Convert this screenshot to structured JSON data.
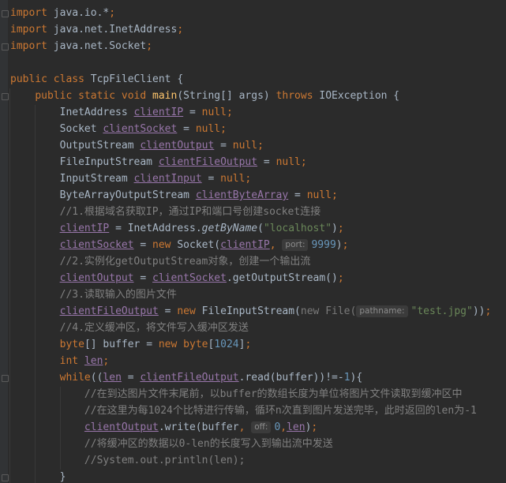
{
  "editor": {
    "theme": "darcula",
    "colors": {
      "background": "#2b2b2b",
      "gutter": "#313335",
      "text": "#a9b7c6",
      "keyword": "#cc7832",
      "method": "#ffc66d",
      "field": "#9876aa",
      "number": "#6897bb",
      "string": "#6a8759",
      "comment": "#808080",
      "hint": "#8c8c8c"
    },
    "lines": [
      [
        {
          "k": "kw",
          "t": "import"
        },
        {
          "t": " java.io.*"
        },
        {
          "k": "kw",
          "t": ";"
        }
      ],
      [
        {
          "k": "kw",
          "t": "import"
        },
        {
          "t": " java.net.InetAddress"
        },
        {
          "k": "kw",
          "t": ";"
        }
      ],
      [
        {
          "k": "kw",
          "t": "import"
        },
        {
          "t": " java.net.Socket"
        },
        {
          "k": "kw",
          "t": ";"
        }
      ],
      [],
      [
        {
          "k": "kw",
          "t": "public class "
        },
        {
          "t": "TcpFileClient {"
        }
      ],
      [
        {
          "t": "    "
        },
        {
          "k": "kw",
          "t": "public static void "
        },
        {
          "k": "fn",
          "t": "main"
        },
        {
          "t": "(String[] args) "
        },
        {
          "k": "kw",
          "t": "throws "
        },
        {
          "t": "IOException {"
        }
      ],
      [
        {
          "t": "        InetAddress "
        },
        {
          "k": "field",
          "t": "clientIP"
        },
        {
          "t": " = "
        },
        {
          "k": "kw",
          "t": "null;"
        }
      ],
      [
        {
          "t": "        Socket "
        },
        {
          "k": "field",
          "t": "clientSocket"
        },
        {
          "t": " = "
        },
        {
          "k": "kw",
          "t": "null;"
        }
      ],
      [
        {
          "t": "        OutputStream "
        },
        {
          "k": "field",
          "t": "clientOutput"
        },
        {
          "t": " = "
        },
        {
          "k": "kw",
          "t": "null;"
        }
      ],
      [
        {
          "t": "        FileInputStream "
        },
        {
          "k": "field",
          "t": "clientFileOutput"
        },
        {
          "t": " = "
        },
        {
          "k": "kw",
          "t": "null;"
        }
      ],
      [
        {
          "t": "        InputStream "
        },
        {
          "k": "field",
          "t": "clientInput"
        },
        {
          "t": " = "
        },
        {
          "k": "kw",
          "t": "null;"
        }
      ],
      [
        {
          "t": "        ByteArrayOutputStream "
        },
        {
          "k": "field",
          "t": "clientByteArray"
        },
        {
          "t": " = "
        },
        {
          "k": "kw",
          "t": "null;"
        }
      ],
      [
        {
          "t": "        "
        },
        {
          "k": "cmt",
          "t": "//1.根据域名获取IP，通过IP和端口号创建socket连接"
        }
      ],
      [
        {
          "t": "        "
        },
        {
          "k": "field",
          "t": "clientIP"
        },
        {
          "t": " = InetAddress."
        },
        {
          "k": "static",
          "t": "getByName"
        },
        {
          "t": "("
        },
        {
          "k": "str",
          "t": "\"localhost\""
        },
        {
          "t": ")"
        },
        {
          "k": "kw",
          "t": ";"
        }
      ],
      [
        {
          "t": "        "
        },
        {
          "k": "field",
          "t": "clientSocket"
        },
        {
          "t": " = "
        },
        {
          "k": "kw",
          "t": "new "
        },
        {
          "t": "Socket("
        },
        {
          "k": "field",
          "t": "clientIP"
        },
        {
          "k": "kw",
          "t": ", "
        },
        {
          "k": "hint",
          "t": "port:"
        },
        {
          "k": "num",
          "t": "9999"
        },
        {
          "t": ")"
        },
        {
          "k": "kw",
          "t": ";"
        }
      ],
      [
        {
          "t": "        "
        },
        {
          "k": "cmt",
          "t": "//2.实例化getOutputStream对象，创建一个输出流"
        }
      ],
      [
        {
          "t": "        "
        },
        {
          "k": "field",
          "t": "clientOutput"
        },
        {
          "t": " = "
        },
        {
          "k": "field",
          "t": "clientSocket"
        },
        {
          "t": ".getOutputStream()"
        },
        {
          "k": "kw",
          "t": ";"
        }
      ],
      [
        {
          "t": "        "
        },
        {
          "k": "cmt",
          "t": "//3.读取输入的图片文件"
        }
      ],
      [
        {
          "t": "        "
        },
        {
          "k": "field",
          "t": "clientFileOutput"
        },
        {
          "t": " = "
        },
        {
          "k": "kw",
          "t": "new "
        },
        {
          "t": "FileInputStream("
        },
        {
          "k": "faint",
          "t": "new File("
        },
        {
          "k": "hint",
          "t": "pathname:"
        },
        {
          "k": "str",
          "t": "\"test.jpg\""
        },
        {
          "t": "))"
        },
        {
          "k": "kw",
          "t": ";"
        }
      ],
      [
        {
          "t": "        "
        },
        {
          "k": "cmt",
          "t": "//4.定义缓冲区，将文件写入缓冲区发送"
        }
      ],
      [
        {
          "t": "        "
        },
        {
          "k": "kw",
          "t": "byte"
        },
        {
          "t": "[] buffer = "
        },
        {
          "k": "kw",
          "t": "new byte"
        },
        {
          "t": "["
        },
        {
          "k": "num",
          "t": "1024"
        },
        {
          "t": "]"
        },
        {
          "k": "kw",
          "t": ";"
        }
      ],
      [
        {
          "t": "        "
        },
        {
          "k": "kw",
          "t": "int "
        },
        {
          "k": "field",
          "t": "len"
        },
        {
          "k": "kw",
          "t": ";"
        }
      ],
      [
        {
          "t": "        "
        },
        {
          "k": "kw",
          "t": "while"
        },
        {
          "t": "(("
        },
        {
          "k": "field",
          "t": "len"
        },
        {
          "t": " = "
        },
        {
          "k": "field",
          "t": "clientFileOutput"
        },
        {
          "t": ".read(buffer))!=-"
        },
        {
          "k": "num",
          "t": "1"
        },
        {
          "t": "){"
        }
      ],
      [
        {
          "t": "            "
        },
        {
          "k": "cmt",
          "t": "//在到达图片文件末尾前，以buffer的数组长度为单位将图片文件读取到缓冲区中"
        }
      ],
      [
        {
          "t": "            "
        },
        {
          "k": "cmt",
          "t": "//在这里为每1024个比特进行传输，循环n次直到图片发送完毕，此时返回的len为-1"
        }
      ],
      [
        {
          "t": "            "
        },
        {
          "k": "field",
          "t": "clientOutput"
        },
        {
          "t": ".write(buffer"
        },
        {
          "k": "kw",
          "t": ", "
        },
        {
          "k": "hint",
          "t": "off:"
        },
        {
          "k": "num",
          "t": "0"
        },
        {
          "k": "kw",
          "t": ","
        },
        {
          "k": "field",
          "t": "len"
        },
        {
          "t": ")"
        },
        {
          "k": "kw",
          "t": ";"
        }
      ],
      [
        {
          "t": "            "
        },
        {
          "k": "cmt",
          "t": "//将缓冲区的数据以0-len的长度写入到输出流中发送"
        }
      ],
      [
        {
          "t": "            "
        },
        {
          "k": "cmt",
          "t": "//System.out.println(len);"
        }
      ],
      [
        {
          "t": "        }"
        }
      ]
    ]
  }
}
